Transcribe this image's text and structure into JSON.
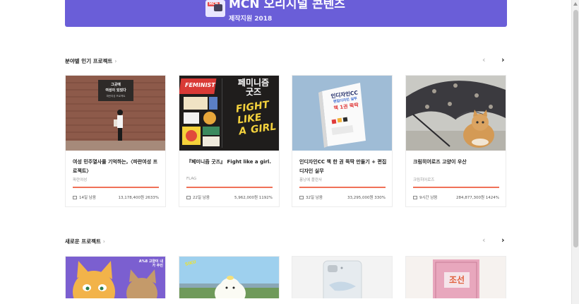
{
  "banner": {
    "logo_tag": "MCN",
    "title": "MCN 오리지널 콘텐츠",
    "subtitle": "제작지원 2018"
  },
  "colors": {
    "accent": "#f07158",
    "banner": "#6a5ed8"
  },
  "sections": [
    {
      "title": "분야별 인기 프로젝트",
      "chevron": "›",
      "prev": "‹",
      "next": "›",
      "cards": [
        {
          "thumb_text": [
            "그곳에",
            "여성이 있었다"
          ],
          "thumb_small": "파란여성 프로젝트",
          "title": "여성 민주열사를 기억하는,〈파란여성 프로젝트〉",
          "creator": "파란여성",
          "days": "14일 남음",
          "amount": "13,178,400원 2633%",
          "progress": 1.0
        },
        {
          "thumb_text": [
            "FEMINIST",
            "페미니즘",
            "굿즈",
            "FIGHT",
            "LIKE",
            "A",
            "GIRL"
          ],
          "title": "『페미니즘 굿즈』 Fight like a girl.",
          "creator": "FLAG",
          "days": "22일 남음",
          "amount": "5,962,000원 1192%",
          "progress": 1.0
        },
        {
          "thumb_text": [
            "인디자인CC",
            "편집디자인 실무",
            "책 1권 뚝딱"
          ],
          "title": "인디자인CC 책 한 권 뚝딱 만들기 + 편집디자인 실무",
          "creator": "퐁낭에 플란사",
          "days": "32일 남음",
          "amount": "33,295,000원 330%",
          "progress": 1.0
        },
        {
          "title": "크림히어로즈 고양이 우산",
          "creator": "크림히어로즈",
          "days": "9시간 남음",
          "amount": "284,877,300원 1424%",
          "progress": 1.0
        }
      ]
    },
    {
      "title": "새로운 프로젝트",
      "chevron": "›",
      "prev": "‹",
      "next": "›",
      "thumbs": [
        {
          "text": "A%8 고양이 내가 주인"
        },
        {
          "text": "SIKU"
        },
        {
          "text": ""
        },
        {
          "text": "조선"
        }
      ]
    }
  ]
}
